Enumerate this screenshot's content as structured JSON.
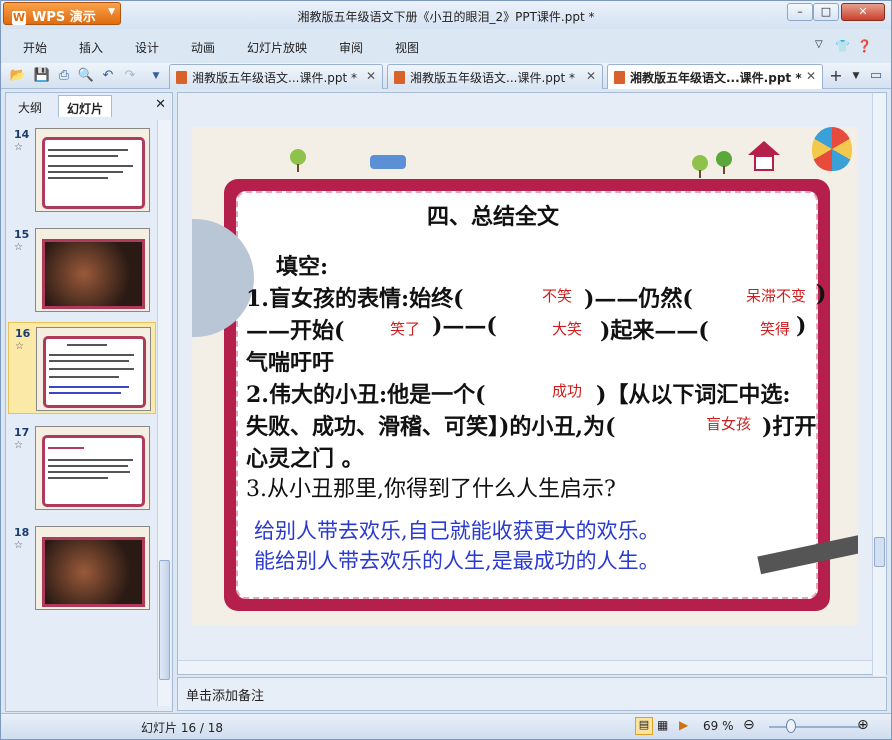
{
  "app": {
    "name": "WPS 演示",
    "window_title": "湘教版五年级语文下册《小丑的眼泪_2》PPT课件.ppt *"
  },
  "menu": [
    "开始",
    "插入",
    "设计",
    "动画",
    "幻灯片放映",
    "审阅",
    "视图"
  ],
  "doc_tabs": [
    {
      "label": "湘教版五年级语文...课件.ppt *",
      "active": false
    },
    {
      "label": "湘教版五年级语文...课件.ppt *",
      "active": false
    },
    {
      "label": "湘教版五年级语文...课件.ppt *",
      "active": true
    }
  ],
  "panel_tabs": {
    "outline": "大纲",
    "slides": "幻灯片"
  },
  "thumbnails": [
    {
      "num": "14"
    },
    {
      "num": "15"
    },
    {
      "num": "16",
      "selected": true
    },
    {
      "num": "17"
    },
    {
      "num": "18"
    }
  ],
  "slide": {
    "title": "四、总结全文",
    "fill_in": "填空:",
    "q1_a": "1.盲女孩的表情:始终(",
    "q1_a_close": ")——仍然(",
    "q1_a_close2": ")",
    "q1_b": "——开始(",
    "q1_b_mid": ")——(",
    "q1_b_mid2": ")起来——(",
    "q1_b_close": ")",
    "q1_c": "气喘吁吁",
    "q2_a": "2.伟大的小丑:他是一个(",
    "q2_a_close": ")【从以下词汇中选:",
    "q2_b": "失败、成功、滑稽、可笑】)的小丑,为(",
    "q2_b_close": ")打开",
    "q2_c": "心灵之门 。",
    "q3": "3.从小丑那里,你得到了什么人生启示?",
    "answers": {
      "a1": "不笑",
      "a2": "呆滞不变",
      "a3": "笑了",
      "a4": "大笑",
      "a5": "笑得",
      "a6": "成功",
      "a7": "盲女孩"
    },
    "insight_1": "给别人带去欢乐,自己就能收获更大的欢乐。",
    "insight_2": "能给别人带去欢乐的人生,是最成功的人生。"
  },
  "notes_placeholder": "单击添加备注",
  "status": {
    "slide_count": "幻灯片 16 / 18",
    "zoom": "69 %"
  }
}
